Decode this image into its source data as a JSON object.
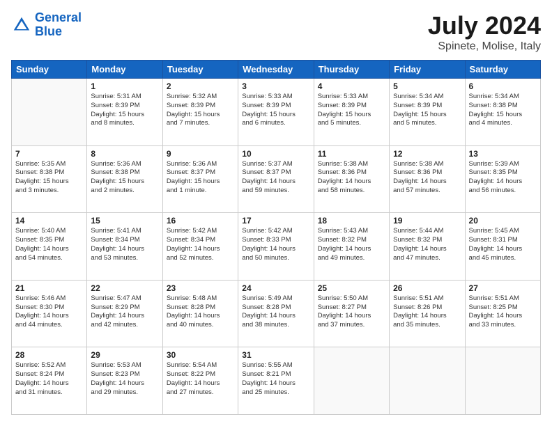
{
  "header": {
    "logo_line1": "General",
    "logo_line2": "Blue",
    "month": "July 2024",
    "location": "Spinete, Molise, Italy"
  },
  "weekdays": [
    "Sunday",
    "Monday",
    "Tuesday",
    "Wednesday",
    "Thursday",
    "Friday",
    "Saturday"
  ],
  "weeks": [
    [
      {
        "day": "",
        "info": ""
      },
      {
        "day": "1",
        "info": "Sunrise: 5:31 AM\nSunset: 8:39 PM\nDaylight: 15 hours\nand 8 minutes."
      },
      {
        "day": "2",
        "info": "Sunrise: 5:32 AM\nSunset: 8:39 PM\nDaylight: 15 hours\nand 7 minutes."
      },
      {
        "day": "3",
        "info": "Sunrise: 5:33 AM\nSunset: 8:39 PM\nDaylight: 15 hours\nand 6 minutes."
      },
      {
        "day": "4",
        "info": "Sunrise: 5:33 AM\nSunset: 8:39 PM\nDaylight: 15 hours\nand 5 minutes."
      },
      {
        "day": "5",
        "info": "Sunrise: 5:34 AM\nSunset: 8:39 PM\nDaylight: 15 hours\nand 5 minutes."
      },
      {
        "day": "6",
        "info": "Sunrise: 5:34 AM\nSunset: 8:38 PM\nDaylight: 15 hours\nand 4 minutes."
      }
    ],
    [
      {
        "day": "7",
        "info": "Sunrise: 5:35 AM\nSunset: 8:38 PM\nDaylight: 15 hours\nand 3 minutes."
      },
      {
        "day": "8",
        "info": "Sunrise: 5:36 AM\nSunset: 8:38 PM\nDaylight: 15 hours\nand 2 minutes."
      },
      {
        "day": "9",
        "info": "Sunrise: 5:36 AM\nSunset: 8:37 PM\nDaylight: 15 hours\nand 1 minute."
      },
      {
        "day": "10",
        "info": "Sunrise: 5:37 AM\nSunset: 8:37 PM\nDaylight: 14 hours\nand 59 minutes."
      },
      {
        "day": "11",
        "info": "Sunrise: 5:38 AM\nSunset: 8:36 PM\nDaylight: 14 hours\nand 58 minutes."
      },
      {
        "day": "12",
        "info": "Sunrise: 5:38 AM\nSunset: 8:36 PM\nDaylight: 14 hours\nand 57 minutes."
      },
      {
        "day": "13",
        "info": "Sunrise: 5:39 AM\nSunset: 8:35 PM\nDaylight: 14 hours\nand 56 minutes."
      }
    ],
    [
      {
        "day": "14",
        "info": "Sunrise: 5:40 AM\nSunset: 8:35 PM\nDaylight: 14 hours\nand 54 minutes."
      },
      {
        "day": "15",
        "info": "Sunrise: 5:41 AM\nSunset: 8:34 PM\nDaylight: 14 hours\nand 53 minutes."
      },
      {
        "day": "16",
        "info": "Sunrise: 5:42 AM\nSunset: 8:34 PM\nDaylight: 14 hours\nand 52 minutes."
      },
      {
        "day": "17",
        "info": "Sunrise: 5:42 AM\nSunset: 8:33 PM\nDaylight: 14 hours\nand 50 minutes."
      },
      {
        "day": "18",
        "info": "Sunrise: 5:43 AM\nSunset: 8:32 PM\nDaylight: 14 hours\nand 49 minutes."
      },
      {
        "day": "19",
        "info": "Sunrise: 5:44 AM\nSunset: 8:32 PM\nDaylight: 14 hours\nand 47 minutes."
      },
      {
        "day": "20",
        "info": "Sunrise: 5:45 AM\nSunset: 8:31 PM\nDaylight: 14 hours\nand 45 minutes."
      }
    ],
    [
      {
        "day": "21",
        "info": "Sunrise: 5:46 AM\nSunset: 8:30 PM\nDaylight: 14 hours\nand 44 minutes."
      },
      {
        "day": "22",
        "info": "Sunrise: 5:47 AM\nSunset: 8:29 PM\nDaylight: 14 hours\nand 42 minutes."
      },
      {
        "day": "23",
        "info": "Sunrise: 5:48 AM\nSunset: 8:28 PM\nDaylight: 14 hours\nand 40 minutes."
      },
      {
        "day": "24",
        "info": "Sunrise: 5:49 AM\nSunset: 8:28 PM\nDaylight: 14 hours\nand 38 minutes."
      },
      {
        "day": "25",
        "info": "Sunrise: 5:50 AM\nSunset: 8:27 PM\nDaylight: 14 hours\nand 37 minutes."
      },
      {
        "day": "26",
        "info": "Sunrise: 5:51 AM\nSunset: 8:26 PM\nDaylight: 14 hours\nand 35 minutes."
      },
      {
        "day": "27",
        "info": "Sunrise: 5:51 AM\nSunset: 8:25 PM\nDaylight: 14 hours\nand 33 minutes."
      }
    ],
    [
      {
        "day": "28",
        "info": "Sunrise: 5:52 AM\nSunset: 8:24 PM\nDaylight: 14 hours\nand 31 minutes."
      },
      {
        "day": "29",
        "info": "Sunrise: 5:53 AM\nSunset: 8:23 PM\nDaylight: 14 hours\nand 29 minutes."
      },
      {
        "day": "30",
        "info": "Sunrise: 5:54 AM\nSunset: 8:22 PM\nDaylight: 14 hours\nand 27 minutes."
      },
      {
        "day": "31",
        "info": "Sunrise: 5:55 AM\nSunset: 8:21 PM\nDaylight: 14 hours\nand 25 minutes."
      },
      {
        "day": "",
        "info": ""
      },
      {
        "day": "",
        "info": ""
      },
      {
        "day": "",
        "info": ""
      }
    ]
  ]
}
